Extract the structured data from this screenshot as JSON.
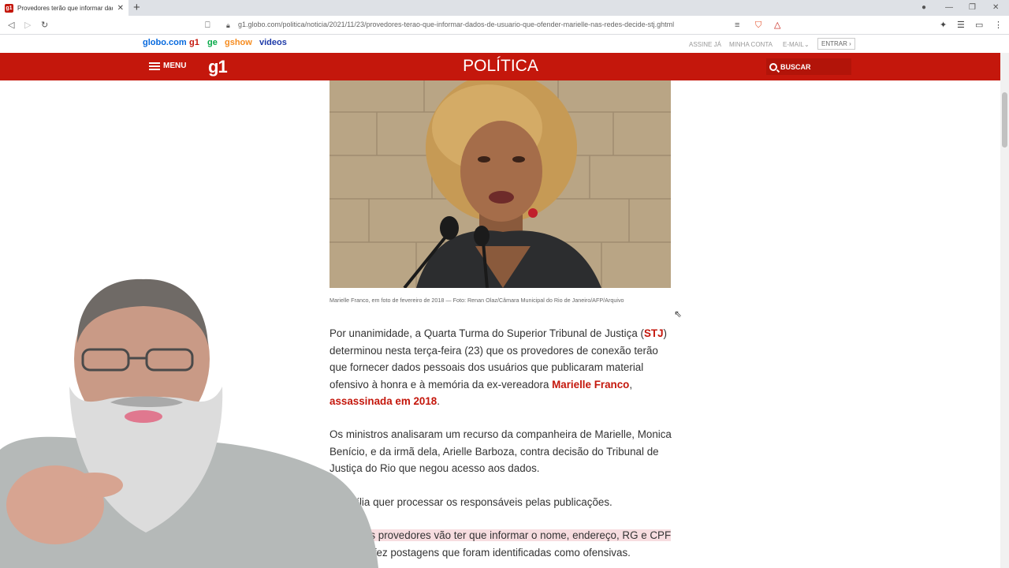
{
  "browser": {
    "tab_title": "Provedores terão que informar dados de usuário",
    "new_tab": "+",
    "url": "g1.globo.com/politica/noticia/2021/11/23/provedores-terao-que-informar-dados-de-usuario-que-ofender-marielle-nas-redes-decide-stj.ghtml"
  },
  "globo_nav": {
    "links": [
      "globo.com",
      "g1",
      "ge",
      "gshow",
      "videos"
    ],
    "right": [
      "ASSINE JÁ",
      "MINHA CONTA",
      "E-MAIL"
    ],
    "login": "ENTRAR ›"
  },
  "header": {
    "menu_label": "MENU",
    "logo": "g1",
    "section": "POLÍTICA",
    "search_label": "BUSCAR"
  },
  "article": {
    "caption": "Marielle Franco, em foto de fevereiro de 2018 — Foto: Renan Olaz/Câmara Municipal do Rio de Janeiro/AFP/Arquivo",
    "p1_a": "Por unanimidade, a Quarta Turma do Superior Tribunal de Justiça (",
    "p1_stj": "STJ",
    "p1_b": ") determinou nesta terça-feira (23) que os provedores de conexão terão que fornecer dados pessoais dos usuários que publicaram material ofensivo à honra e à memória da ex-vereadora ",
    "p1_marielle": "Marielle Franco",
    "p1_c": ", ",
    "p1_assassinada": "assassinada em 2018",
    "p1_d": ".",
    "p2": "Os ministros analisaram um recurso da companheira de Marielle, Monica Benício, e da irmã dela, Arielle Barboza, contra decisão do Tribunal de Justiça do Rio que negou acesso aos dados.",
    "p3": "A família quer processar os responsáveis pelas publicações.",
    "p4_a": "Assim, os provedores vão ter que informar o nome, endereço, RG e CPF",
    "p4_b": "de quem fez postagens que foram identificadas como ofensivas."
  },
  "colors": {
    "brand_red": "#c4170c",
    "link_red": "#c4170c",
    "highlight": "#f7dde0"
  }
}
